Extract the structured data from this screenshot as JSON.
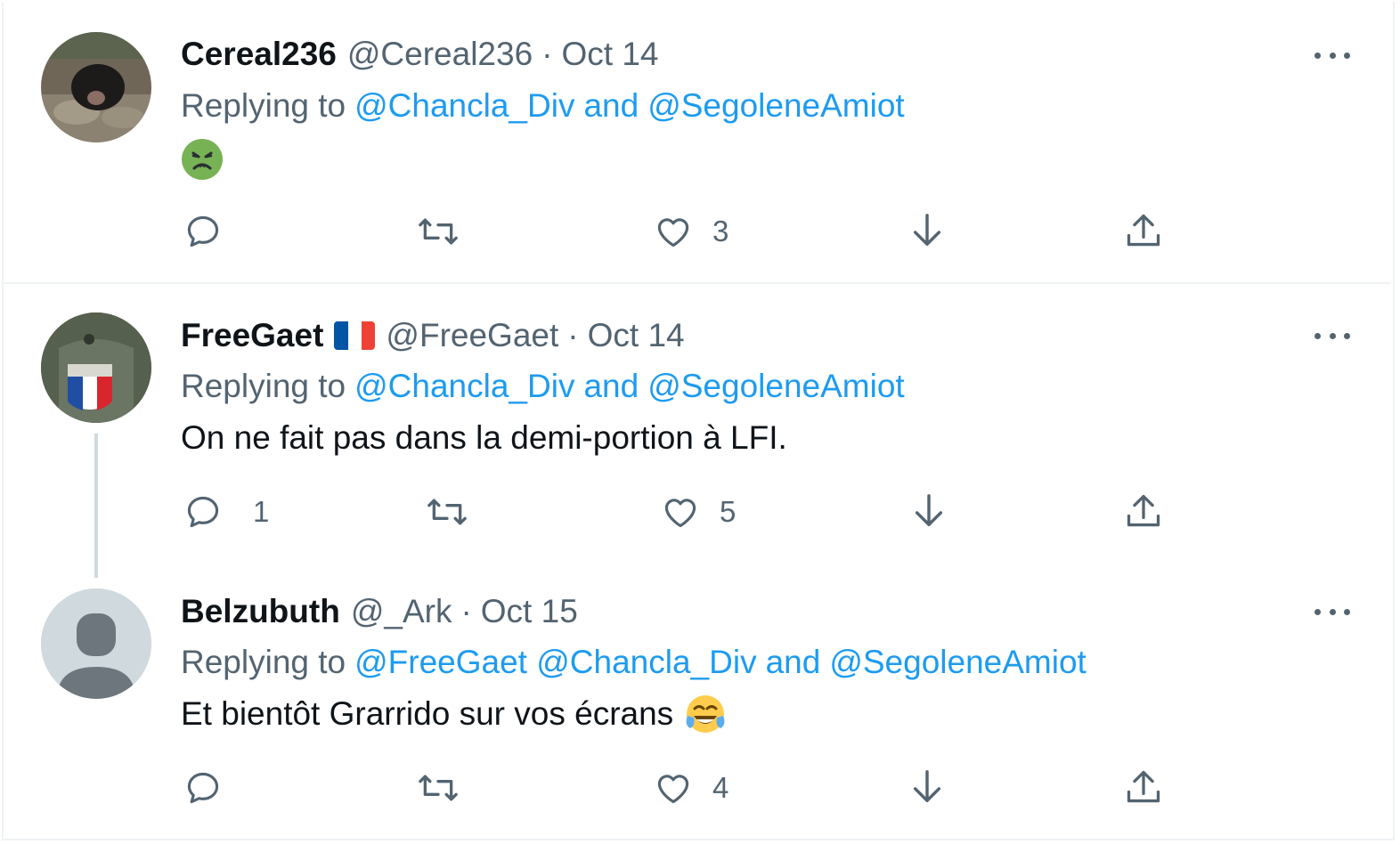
{
  "colors": {
    "link": "#1d9bf0",
    "secondary": "#536471",
    "primary": "#0f1419",
    "border": "#eff3f4"
  },
  "tweets": [
    {
      "name": "Cereal236",
      "handle": "@Cereal236",
      "sep": "·",
      "date": "Oct 14",
      "replying_label": "Replying to",
      "mentions": "@Chancla_Div",
      "and_label": "and",
      "mention2": "@SegoleneAmiot",
      "text": "",
      "emoji": "nauseated-face-icon",
      "replies": "",
      "likes": "3"
    },
    {
      "name": "FreeGaet",
      "flag": "french-flag-icon",
      "handle": "@FreeGaet",
      "sep": "·",
      "date": "Oct 14",
      "replying_label": "Replying to",
      "mentions": "@Chancla_Div",
      "and_label": "and",
      "mention2": "@SegoleneAmiot",
      "text": "On ne fait pas dans la demi-portion à LFI.",
      "replies": "1",
      "likes": "5"
    },
    {
      "name": "Belzubuth",
      "handle": "@_Ark",
      "sep": "·",
      "date": "Oct 15",
      "replying_label": "Replying to",
      "mentions": "@FreeGaet @Chancla_Div",
      "and_label": "and",
      "mention2": "@SegoleneAmiot",
      "text": "Et bientôt Grarrido sur vos écrans",
      "emoji": "tears-of-joy-icon",
      "replies": "",
      "likes": "4"
    }
  ]
}
